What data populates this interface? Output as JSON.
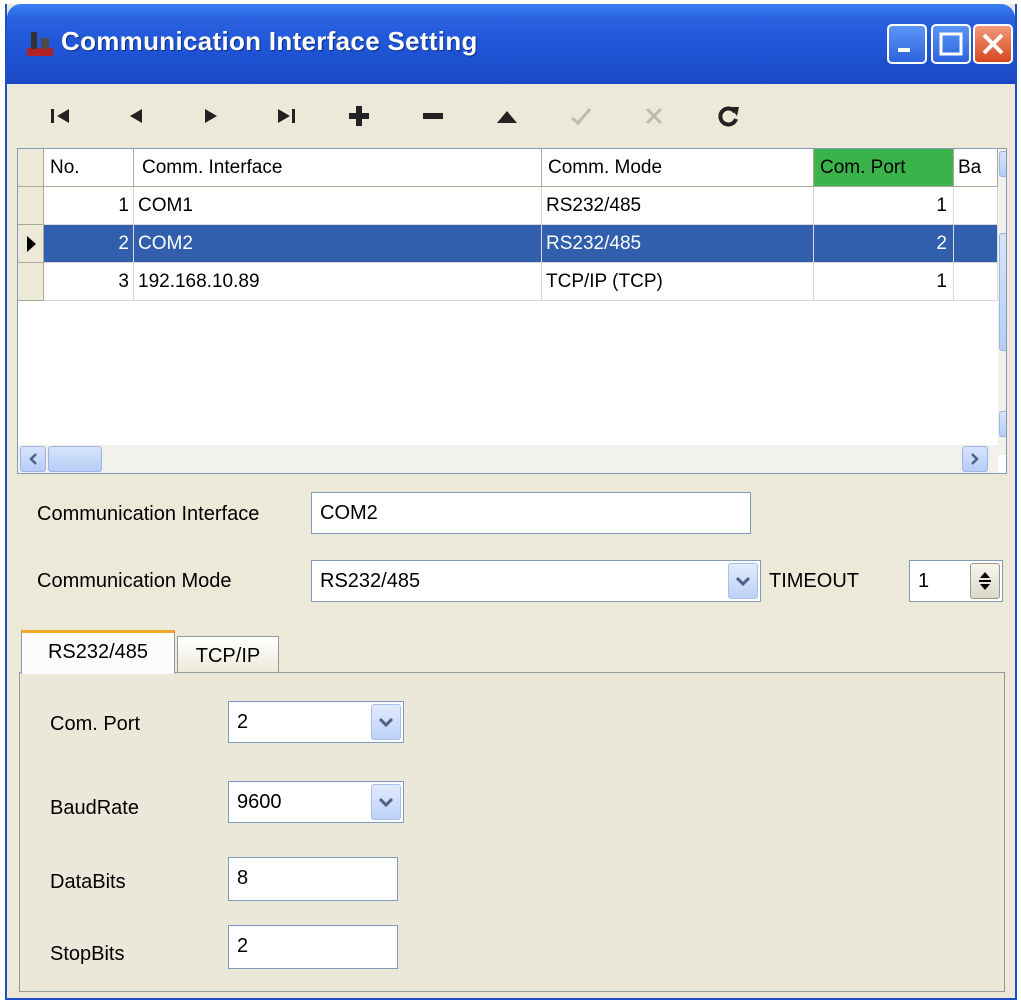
{
  "window": {
    "title": "Communication Interface Setting"
  },
  "toolbar": {
    "buttons": [
      "first-record",
      "prior-record",
      "next-record",
      "last-record",
      "insert-record",
      "delete-record",
      "edit-record",
      "post-edit",
      "cancel-edit",
      "refresh-data"
    ]
  },
  "grid": {
    "columns": [
      "No.",
      "Comm. Interface",
      "Comm. Mode",
      "Com. Port",
      "Ba"
    ],
    "rows": [
      {
        "no": "1",
        "interface": "COM1",
        "mode": "RS232/485",
        "port": "1"
      },
      {
        "no": "2",
        "interface": "COM2",
        "mode": "RS232/485",
        "port": "2"
      },
      {
        "no": "3",
        "interface": "192.168.10.89",
        "mode": "TCP/IP (TCP)",
        "port": "1"
      }
    ],
    "selected_row": 2,
    "highlight_color": "#3ab44a",
    "selection_color": "#315fad"
  },
  "form": {
    "interface_label": "Communication Interface",
    "interface_value": "COM2",
    "mode_label": "Communication Mode",
    "mode_value": "RS232/485",
    "timeout_label": "TIMEOUT",
    "timeout_value": "1"
  },
  "tabs": [
    {
      "label": "RS232/485",
      "active": true
    },
    {
      "label": "TCP/IP",
      "active": false
    }
  ],
  "serial": {
    "port_label": "Com. Port",
    "port_value": "2",
    "baud_label": "BaudRate",
    "baud_value": "9600",
    "databits_label": "DataBits",
    "databits_value": "8",
    "stopbits_label": "StopBits",
    "stopbits_value": "2"
  }
}
